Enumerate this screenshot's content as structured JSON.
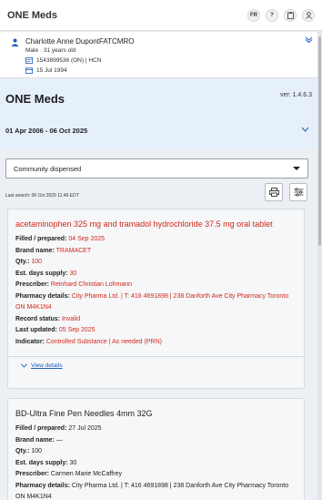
{
  "app": {
    "title": "ONE Meds"
  },
  "header_icons": [
    {
      "label": "FR",
      "name": "language-toggle-button"
    },
    {
      "label": "?",
      "name": "help-icon"
    },
    {
      "label": "",
      "name": "clipboard-icon"
    },
    {
      "label": "",
      "name": "user-icon"
    }
  ],
  "patient": {
    "name": "Charlotte Anne DupontFATCMRO",
    "sex_age": "Male  ·  31 years old",
    "health_card": "1543899536 (ON) | HCN",
    "dob": "15 Jul 1994"
  },
  "page": {
    "title": "ONE Meds",
    "version": "ver: 1.4.6.3",
    "date_range": "01 Apr 2006 - 06 Oct 2025"
  },
  "filter": {
    "selected": "Community dispensed",
    "last_search": "Last search: 06 Oct 2025 11:40 EDT"
  },
  "labels": {
    "filled": "Filled / prepared:",
    "brand": "Brand name:",
    "qty": "Qty.:",
    "days": "Est. days supply:",
    "prescriber": "Prescriber:",
    "pharmacy": "Pharmacy details:",
    "status": "Record status:",
    "updated": "Last updated:",
    "indicator": "Indicator:",
    "view_details": "View details"
  },
  "cards": [
    {
      "title": "acetaminophen 325 mg and tramadol hydrochloride 37.5 mg oral tablet",
      "filled": "04 Sep 2025",
      "brand": "TRAMACET",
      "qty": "100",
      "days": "30",
      "prescriber": "Reinhard Christian Lohmann",
      "pharmacy": "City Pharma Ltd. | T: 416 4691898 | 238 Danforth Ave  City Pharmacy Toronto ON M4K1N4",
      "status": "Invalid",
      "updated": "05 Sep 2025",
      "indicator": "Controlled Substance | As needed (PRN)"
    },
    {
      "title": "BD-Ultra Fine Pen Needles 4mm 32G",
      "filled": "27 Jul 2025",
      "brand": "—",
      "qty": "100",
      "days": "30",
      "prescriber": "Carmen Marie McCaffrey",
      "pharmacy": "City Pharma Ltd. | T: 416 4691898 | 238 Danforth Ave  City Pharmacy Toronto ON M4K1N4"
    }
  ],
  "colors": {
    "accent": "#1f5fb8",
    "alert": "#d0281b",
    "header_bg": "#e6f0fb"
  }
}
